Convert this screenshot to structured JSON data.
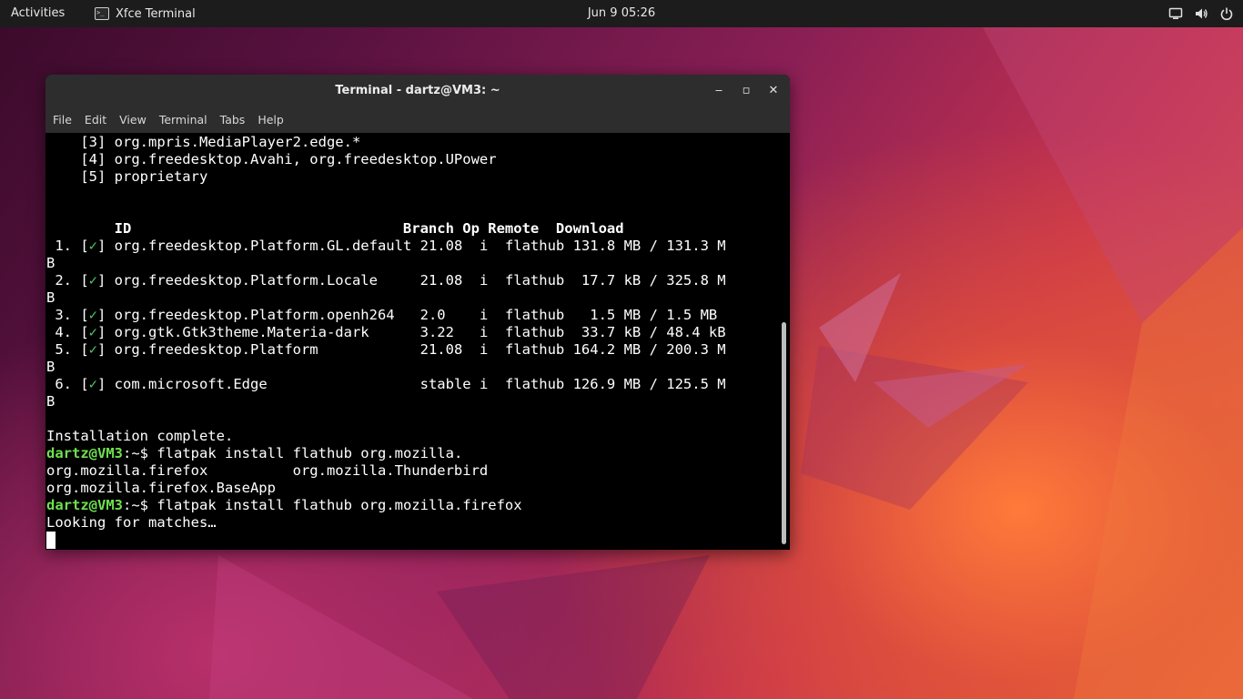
{
  "topbar": {
    "activities": "Activities",
    "app_name": "Xfce Terminal",
    "clock": "Jun 9  05:26",
    "tray_icons": [
      "display-icon",
      "volume-icon",
      "power-icon"
    ]
  },
  "window": {
    "title": "Terminal - dartz@VM3: ~",
    "controls": {
      "minimize": "‒",
      "maximize": "▫",
      "close": "✕"
    },
    "menu": [
      "File",
      "Edit",
      "View",
      "Terminal",
      "Tabs",
      "Help"
    ]
  },
  "terminal": {
    "lines": [
      [
        "    [3] org.mpris.MediaPlayer2.edge.*"
      ],
      [
        "    [4] org.freedesktop.Avahi, org.freedesktop.UPower"
      ],
      [
        "    [5] proprietary"
      ],
      [
        ""
      ],
      [
        ""
      ],
      [
        {
          "t": "        ID                                Branch Op Remote  Download",
          "c": "b"
        }
      ],
      [
        " 1. [",
        {
          "t": "✓",
          "c": "ck"
        },
        "] org.freedesktop.Platform.GL.default 21.08  i  flathub 131.8 MB / 131.3 M"
      ],
      [
        "B"
      ],
      [
        " 2. [",
        {
          "t": "✓",
          "c": "ck"
        },
        "] org.freedesktop.Platform.Locale     21.08  i  flathub  17.7 kB / 325.8 M"
      ],
      [
        "B"
      ],
      [
        " 3. [",
        {
          "t": "✓",
          "c": "ck"
        },
        "] org.freedesktop.Platform.openh264   2.0    i  flathub   1.5 MB / 1.5 MB"
      ],
      [
        " 4. [",
        {
          "t": "✓",
          "c": "ck"
        },
        "] org.gtk.Gtk3theme.Materia-dark      3.22   i  flathub  33.7 kB / 48.4 kB"
      ],
      [
        " 5. [",
        {
          "t": "✓",
          "c": "ck"
        },
        "] org.freedesktop.Platform            21.08  i  flathub 164.2 MB / 200.3 M"
      ],
      [
        "B"
      ],
      [
        " 6. [",
        {
          "t": "✓",
          "c": "ck"
        },
        "] com.microsoft.Edge                  stable i  flathub 126.9 MB / 125.5 M"
      ],
      [
        "B"
      ],
      [
        ""
      ],
      [
        "Installation complete."
      ],
      [
        {
          "t": "dartz@VM3",
          "c": "g"
        },
        ":~$ flatpak install flathub org.mozilla."
      ],
      [
        "org.mozilla.firefox          org.mozilla.Thunderbird"
      ],
      [
        "org.mozilla.firefox.BaseApp"
      ],
      [
        {
          "t": "dartz@VM3",
          "c": "g"
        },
        ":~$ flatpak install flathub org.mozilla.firefox"
      ],
      [
        "Looking for matches…"
      ],
      [
        {
          "t": "",
          "c": "cursor"
        }
      ]
    ]
  }
}
